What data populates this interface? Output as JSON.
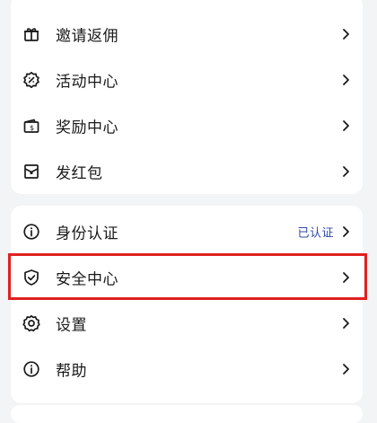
{
  "menu_group_1": {
    "items": [
      {
        "label": "邀请返佣",
        "icon": "gift-icon"
      },
      {
        "label": "活动中心",
        "icon": "activity-badge-icon"
      },
      {
        "label": "奖励中心",
        "icon": "wallet-dollar-icon"
      },
      {
        "label": "发红包",
        "icon": "red-packet-icon"
      }
    ]
  },
  "menu_group_2": {
    "items": [
      {
        "label": "身份认证",
        "icon": "info-icon",
        "status": "已认证"
      },
      {
        "label": "安全中心",
        "icon": "shield-check-icon"
      },
      {
        "label": "设置",
        "icon": "gear-icon"
      },
      {
        "label": "帮助",
        "icon": "help-info-icon"
      }
    ]
  },
  "colors": {
    "background": "#f3f4f6",
    "card": "#ffffff",
    "text": "#1a1a1a",
    "status_text": "#2f4aa8",
    "highlight_border": "#e02020"
  }
}
